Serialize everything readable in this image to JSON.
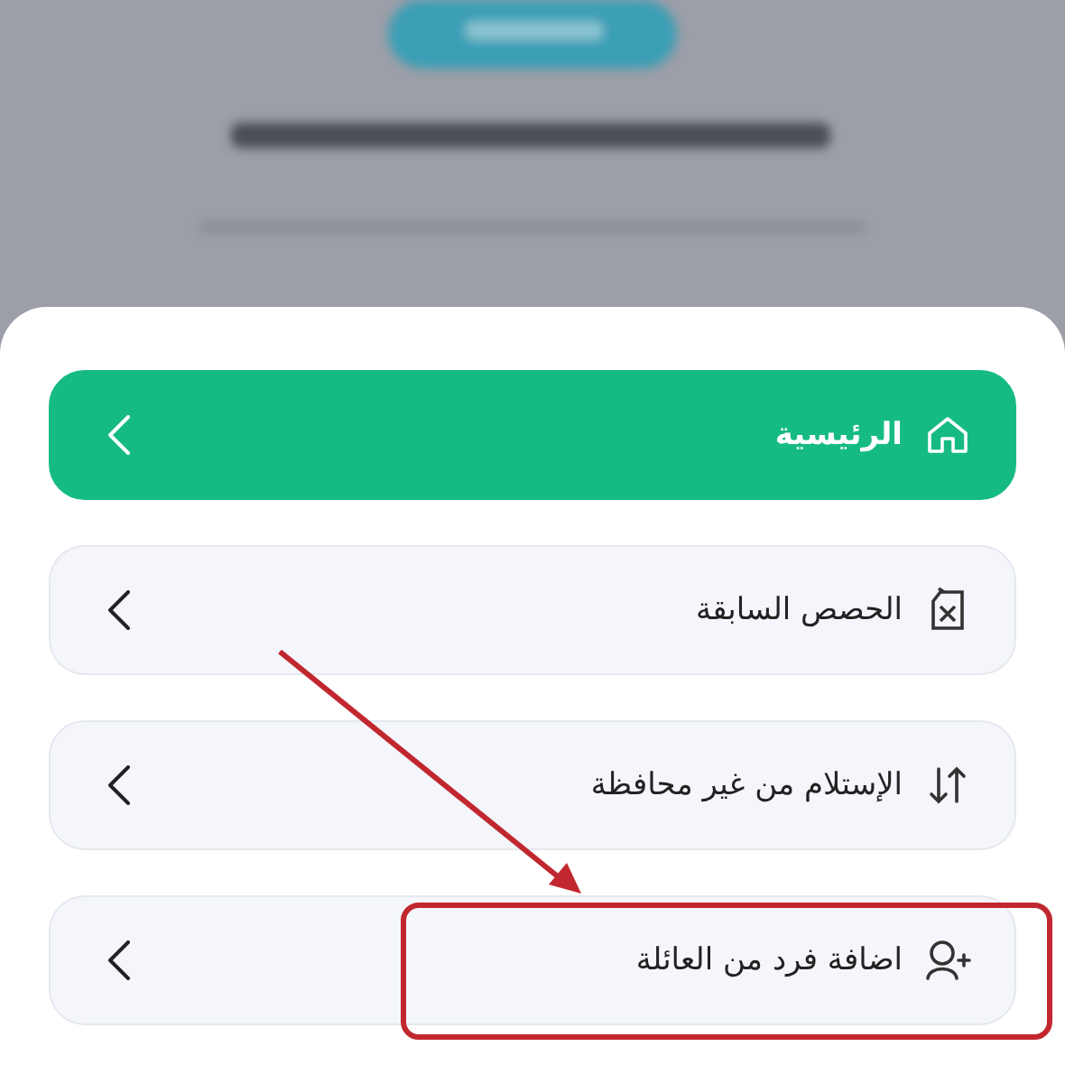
{
  "menu": {
    "items": [
      {
        "kind": "home",
        "label": "الرئيسية",
        "selected": true,
        "highlighted": false
      },
      {
        "kind": "history",
        "label": "الحصص السابقة",
        "selected": false,
        "highlighted": false
      },
      {
        "kind": "transfer",
        "label": "الإستلام من غير محافظة",
        "selected": false,
        "highlighted": false
      },
      {
        "kind": "add-member",
        "label": "اضافة فرد من العائلة",
        "selected": false,
        "highlighted": true
      }
    ]
  }
}
